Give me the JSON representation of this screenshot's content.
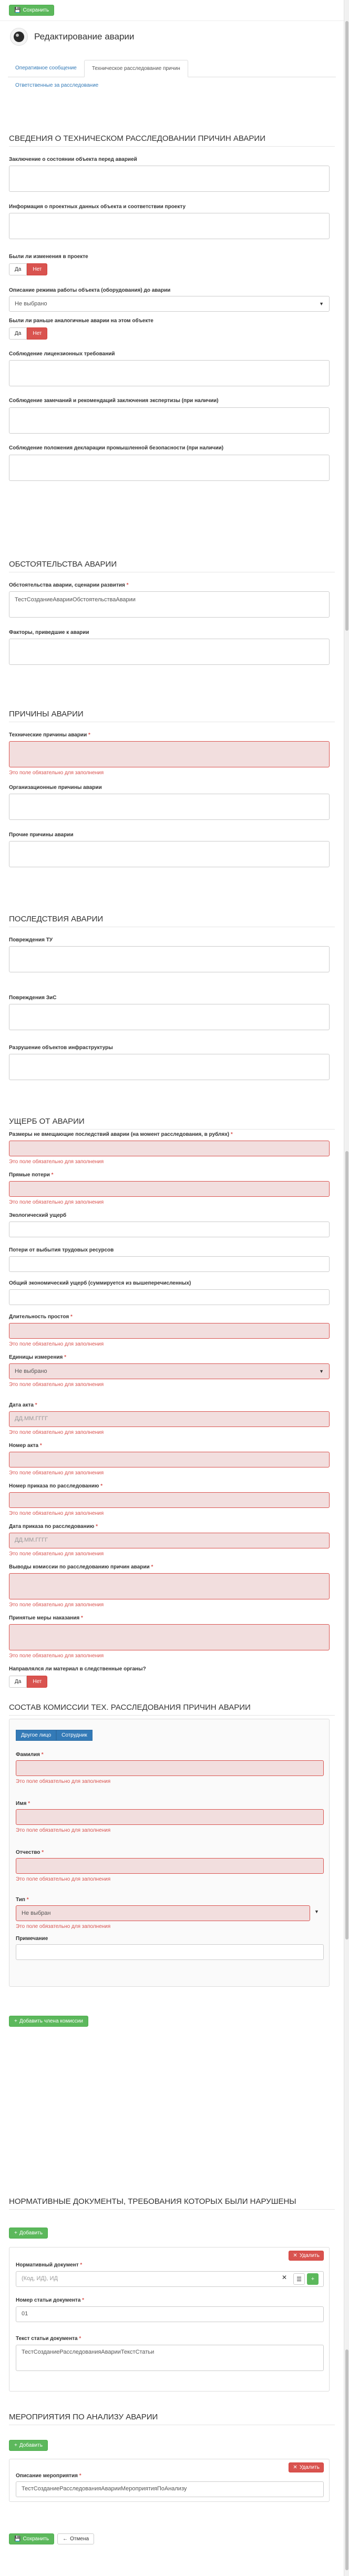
{
  "topbar": {
    "save_label": "Сохранить"
  },
  "header": {
    "title": "Редактирование аварии"
  },
  "tabs": {
    "items": [
      "Оперативное сообщение",
      "Техническое расследование причин"
    ],
    "second_row": "Ответственные за расследование"
  },
  "s1": {
    "title": "Сведения о техническом расследовании причин аварии",
    "f1_label": "Заключение о состоянии объекта перед аварией",
    "f2_label": "Информация о проектных данных объекта и соответствии проекту",
    "f3_label": "Были ли изменения в проекте",
    "yes": "Да",
    "no": "Нет",
    "f4_label": "Описание режима работы объекта (оборудования) до аварии",
    "f4_value": "Не выбрано",
    "f5_label": "Были ли раньше аналогичные аварии на этом объекте",
    "f6_label": "Соблюдение лицензионных требований",
    "f7_label": "Соблюдение замечаний и рекомендаций заключения экспертизы (при наличии)",
    "f8_label": "Соблюдение положения декларации промышленной безопасности (при наличии)"
  },
  "s2": {
    "title": "Обстоятельства аварии",
    "f1_label": "Обстоятельства аварии, сценарии развития",
    "f1_value": "ТестСозданиеАварииОбстоятельстваАварии",
    "f2_label": "Факторы, приведшие к аварии"
  },
  "s3": {
    "title": "Причины аварии",
    "f1_label": "Технические причины аварии",
    "f2_label": "Организационные причины аварии",
    "f3_label": "Прочие причины аварии"
  },
  "s4": {
    "title": "Последствия аварии",
    "f1_label": "Повреждения ТУ",
    "f2_label": "Повреждения ЗиС",
    "f3_label": "Разрушение объектов инфраструктуры"
  },
  "s5": {
    "title": "Ущерб от аварии",
    "f1_label": "Размеры не вмещающие последствий аварии (на момент расследования, в рублях)",
    "f2_label": "Прямые потери",
    "f3_label": "Экологический ущерб",
    "f4_label": "Потери от выбытия трудовых ресурсов",
    "f5_label": "Общий экономический ущерб (суммируется из вышеперечисленных)",
    "f6_label": "Длительность простоя",
    "f7_label": "Единицы измерения",
    "f7_value": "Не выбрано",
    "f8_label": "Дата акта",
    "f9_label": "Номер акта",
    "f10_label": "Номер приказа по расследованию",
    "f11_label": "Дата приказа по расследованию",
    "f12_label": "Выводы комиссии по расследованию причин аварии",
    "f13_label": "Принятые меры наказания",
    "f14_label": "Направлялся ли материал в следственные органы?",
    "date_placeholder": "ДД.ММ.ГГГГ",
    "required_msg": "Это поле обязательно для заполнения"
  },
  "s6": {
    "title": "Состав комиссии тех. расследования причин аварии",
    "tab_other": "Другое лицо",
    "tab_employee": "Сотрудник",
    "f1_label": "Фамилия",
    "f2_label": "Имя",
    "f3_label": "Отчество",
    "f4_label": "Тип",
    "f4_value": "Не выбран",
    "f5_label": "Примечание",
    "add_member": "Добавить члена комиссии"
  },
  "s7": {
    "title": "Нормативные документы, требования которых были нарушены",
    "add_label": "Добавить",
    "delete_label": "Удалить",
    "f1_label": "Нормативный документ",
    "f1_placeholder": "(Код, ИД), ИД",
    "f2_label": "Номер статьи документа",
    "f2_value": "01",
    "f3_label": "Текст статьи документа",
    "f3_value": "ТестСозданиеРасследованияАварииТекстСтатьи"
  },
  "s8": {
    "title": "Мероприятия по анализу аварии",
    "add_label": "Добавить",
    "delete_label": "Удалить",
    "f1_label": "Описание мероприятия",
    "f1_value": "ТестСозданиеРасследованияАварииМероприятияПоАнализу"
  },
  "footer": {
    "save_label": "Сохранить",
    "back_label": "Отмена"
  },
  "colors": {
    "primary": "#337ab7",
    "success": "#5cb85c",
    "danger": "#d9534f",
    "error_bg": "#f2dede"
  }
}
